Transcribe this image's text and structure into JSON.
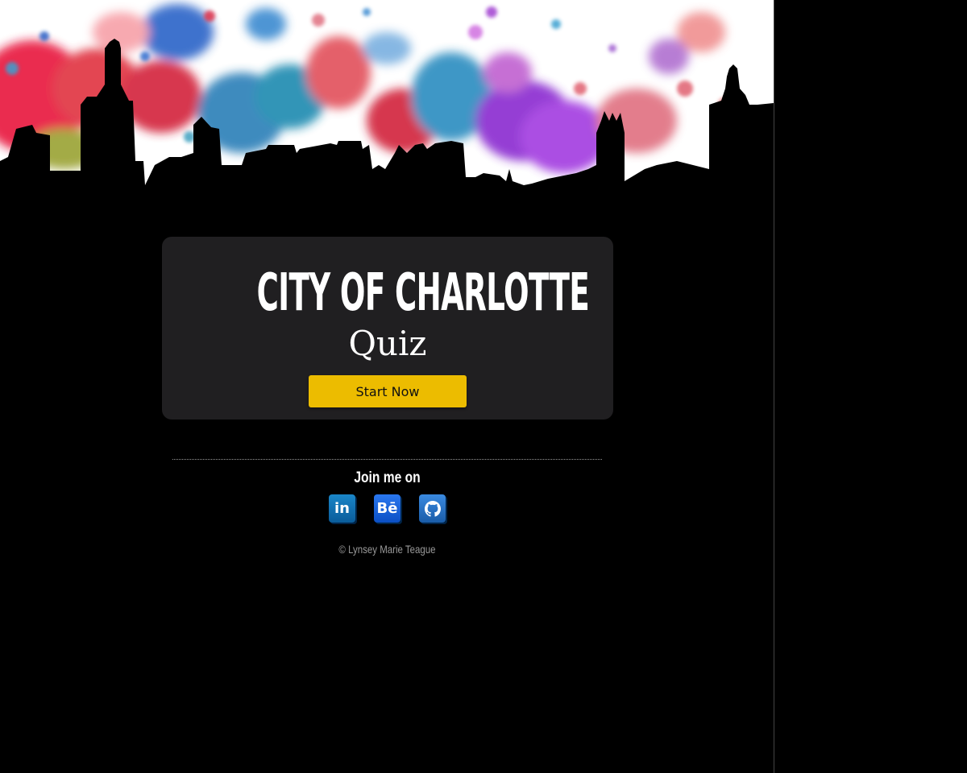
{
  "hero": {
    "image": "charlotte-skyline-paint-splatter"
  },
  "card": {
    "title": "CITY OF CHARLOTTE",
    "subtitle": "Quiz",
    "start_label": "Start Now"
  },
  "footer": {
    "join_label": "Join me on",
    "socials": [
      {
        "icon": "linkedin-icon",
        "glyph": "in"
      },
      {
        "icon": "behance-icon",
        "glyph": "Bē"
      },
      {
        "icon": "github-icon",
        "glyph": ""
      }
    ],
    "copyright": "© Lynsey Marie Teague"
  },
  "colors": {
    "background": "#000000",
    "card": "#201f21",
    "button": "#ecbc00",
    "muted_text": "#9a9a9a"
  }
}
